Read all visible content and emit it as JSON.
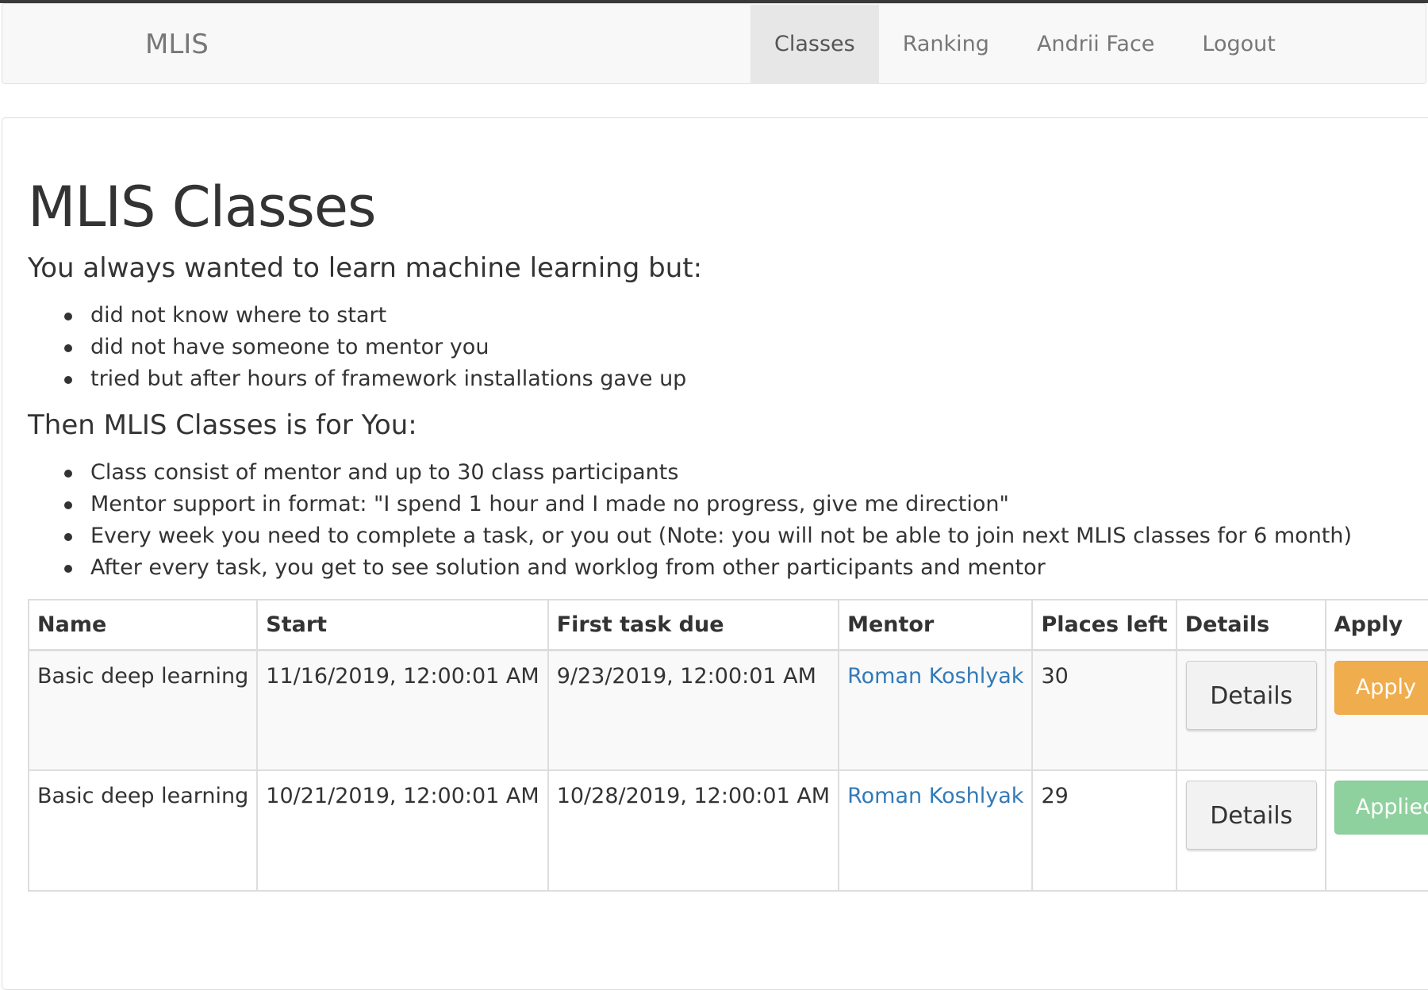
{
  "navbar": {
    "brand": "MLIS",
    "items": [
      {
        "label": "Classes",
        "active": true
      },
      {
        "label": "Ranking",
        "active": false
      },
      {
        "label": "Andrii Face",
        "active": false
      },
      {
        "label": "Logout",
        "active": false
      }
    ]
  },
  "page": {
    "title": "MLIS Classes",
    "intro_heading": "You always wanted to learn machine learning but:",
    "intro_points": [
      "did not know where to start",
      "did not have someone to mentor you",
      "tried but after hours of framework installations gave up"
    ],
    "offer_heading": "Then MLIS Classes is for You:",
    "offer_points": [
      "Class consist of mentor and up to 30 class participants",
      "Mentor support in format: \"I spend 1 hour and I made no progress, give me direction\"",
      "Every week you need to complete a task, or you out (Note: you will not be able to join next MLIS classes for 6 month)",
      "After every task, you get to see solution and worklog from other participants and mentor"
    ]
  },
  "table": {
    "headers": [
      "Name",
      "Start",
      "First task due",
      "Mentor",
      "Places left",
      "Details",
      "Apply"
    ],
    "rows": [
      {
        "name": "Basic deep learning",
        "start": "11/16/2019, 12:00:01 AM",
        "first_task_due": "9/23/2019, 12:00:01 AM",
        "mentor": "Roman Koshlyak",
        "places_left": "30",
        "details_label": "Details",
        "apply_label": "Apply",
        "apply_state": "open"
      },
      {
        "name": "Basic deep learning",
        "start": "10/21/2019, 12:00:01 AM",
        "first_task_due": "10/28/2019, 12:00:01 AM",
        "mentor": "Roman Koshlyak",
        "places_left": "29",
        "details_label": "Details",
        "apply_label": "Applied",
        "apply_state": "applied"
      }
    ]
  },
  "colors": {
    "link": "#337ab7",
    "apply": "#f0ad4e",
    "applied": "#8fd19e",
    "navbar_bg": "#f8f8f8",
    "nav_active_bg": "#e7e7e7"
  }
}
